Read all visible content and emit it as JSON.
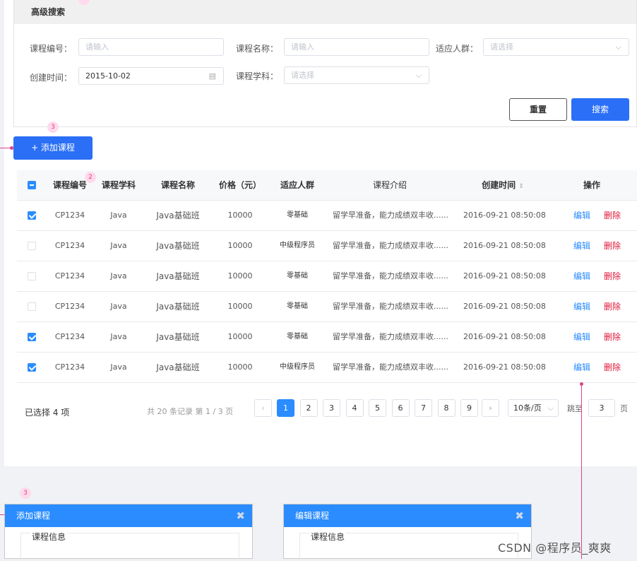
{
  "search": {
    "title": "高级搜索",
    "fields": {
      "course_code_label": "课程编号：",
      "course_code_placeholder": "请输入",
      "course_name_label": "课程名称：",
      "course_name_placeholder": "请输入",
      "audience_label": "适应人群：",
      "audience_placeholder": "请选择",
      "created_label": "创建时间：",
      "created_value": "2015-10-02",
      "subject_label": "课程学科：",
      "subject_placeholder": "请选择"
    },
    "reset_label": "重置",
    "search_label": "搜索"
  },
  "toolbar": {
    "add_label": "+ 添加课程"
  },
  "markers": {
    "m1": "3",
    "m2": "2",
    "m3": "3"
  },
  "table": {
    "columns": [
      "课程编号",
      "课程学科",
      "课程名称",
      "价格（元）",
      "适应人群",
      "课程介绍",
      "创建时间",
      "操作"
    ],
    "sort_icon": "⇕",
    "rows": [
      {
        "checked": true,
        "code": "CP1234",
        "subject": "Java",
        "name": "Java基础班",
        "price": "10000",
        "audience": "零基础",
        "intro": "留学早准备，能力成绩双丰收......",
        "created": "2016-09-21  08:50:08",
        "edit": "编辑",
        "del": "删除"
      },
      {
        "checked": false,
        "code": "CP1234",
        "subject": "Java",
        "name": "Java基础班",
        "price": "10000",
        "audience": "中级程序员",
        "intro": "留学早准备，能力成绩双丰收......",
        "created": "2016-09-21  08:50:08",
        "edit": "编辑",
        "del": "删除"
      },
      {
        "checked": false,
        "code": "CP1234",
        "subject": "Java",
        "name": "Java基础班",
        "price": "10000",
        "audience": "零基础",
        "intro": "留学早准备，能力成绩双丰收......",
        "created": "2016-09-21  08:50:08",
        "edit": "编辑",
        "del": "删除"
      },
      {
        "checked": false,
        "code": "CP1234",
        "subject": "Java",
        "name": "Java基础班",
        "price": "10000",
        "audience": "零基础",
        "intro": "留学早准备，能力成绩双丰收......",
        "created": "2016-09-21  08:50:08",
        "edit": "编辑",
        "del": "删除"
      },
      {
        "checked": true,
        "code": "CP1234",
        "subject": "Java",
        "name": "Java基础班",
        "price": "10000",
        "audience": "零基础",
        "intro": "留学早准备，能力成绩双丰收......",
        "created": "2016-09-21  08:50:08",
        "edit": "编辑",
        "del": "删除"
      },
      {
        "checked": true,
        "code": "CP1234",
        "subject": "Java",
        "name": "Java基础班",
        "price": "10000",
        "audience": "中级程序员",
        "intro": "留学早准备，能力成绩双丰收......",
        "created": "2016-09-21  08:50:08",
        "edit": "编辑",
        "del": "删除"
      }
    ]
  },
  "footer": {
    "selected": "已选择 4 项",
    "total": "共 20 条记录 第 1 / 3 页",
    "pages": [
      "1",
      "2",
      "3",
      "4",
      "5",
      "6",
      "7",
      "8",
      "9"
    ],
    "page_size": "10条/页",
    "jump_label": "跳至",
    "jump_value": "3",
    "page_unit": "页"
  },
  "modals": {
    "add_title": "添加课程",
    "edit_title": "编辑课程",
    "section_title": "课程信息"
  },
  "watermark": "CSDN @程序员_爽爽",
  "colors": {
    "primary": "#2a6ff6",
    "accent": "#2a8cff",
    "danger": "#e0183a",
    "annotation": "#e0418b"
  }
}
